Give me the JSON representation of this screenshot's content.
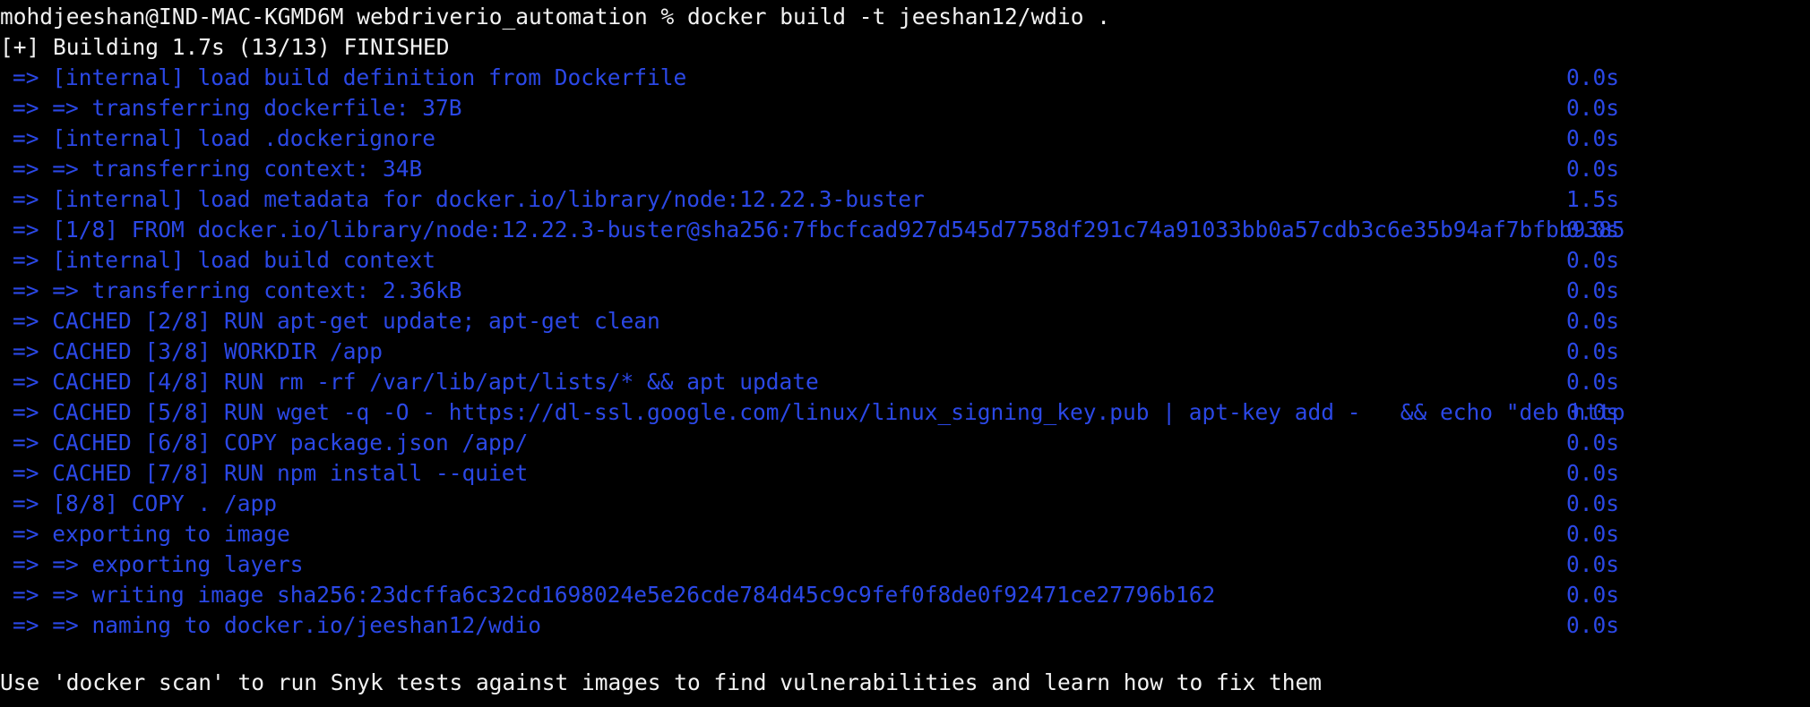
{
  "terminal": {
    "prompt": "mohdjeeshan@IND-MAC-KGMD6M webdriverio_automation % docker build -t jeeshan12/wdio .",
    "build_header": "[+] Building 1.7s (13/13) FINISHED",
    "steps": [
      {
        "text": "=> [internal] load build definition from Dockerfile",
        "time": "0.0s"
      },
      {
        "text": "=> => transferring dockerfile: 37B",
        "time": "0.0s"
      },
      {
        "text": "=> [internal] load .dockerignore",
        "time": "0.0s"
      },
      {
        "text": "=> => transferring context: 34B",
        "time": "0.0s"
      },
      {
        "text": "=> [internal] load metadata for docker.io/library/node:12.22.3-buster",
        "time": "1.5s"
      },
      {
        "text": "=> [1/8] FROM docker.io/library/node:12.22.3-buster@sha256:7fbcfcad927d545d7758df291c74a91033bb0a57cdb3c6e35b94af7bfbb9385",
        "time": "0.0s"
      },
      {
        "text": "=> [internal] load build context",
        "time": "0.0s"
      },
      {
        "text": "=> => transferring context: 2.36kB",
        "time": "0.0s"
      },
      {
        "text": "=> CACHED [2/8] RUN apt-get update; apt-get clean",
        "time": "0.0s"
      },
      {
        "text": "=> CACHED [3/8] WORKDIR /app",
        "time": "0.0s"
      },
      {
        "text": "=> CACHED [4/8] RUN rm -rf /var/lib/apt/lists/* && apt update",
        "time": "0.0s"
      },
      {
        "text": "=> CACHED [5/8] RUN wget -q -O - https://dl-ssl.google.com/linux/linux_signing_key.pub | apt-key add -   && echo \"deb http",
        "time": "0.0s"
      },
      {
        "text": "=> CACHED [6/8] COPY package.json /app/",
        "time": "0.0s"
      },
      {
        "text": "=> CACHED [7/8] RUN npm install --quiet",
        "time": "0.0s"
      },
      {
        "text": "=> [8/8] COPY . /app",
        "time": "0.0s"
      },
      {
        "text": "=> exporting to image",
        "time": "0.0s"
      },
      {
        "text": "=> => exporting layers",
        "time": "0.0s"
      },
      {
        "text": "=> => writing image sha256:23dcffa6c32cd1698024e5e26cde784d45c9c9fef0f8de0f92471ce27796b162",
        "time": "0.0s"
      },
      {
        "text": "=> => naming to docker.io/jeeshan12/wdio",
        "time": "0.0s"
      }
    ],
    "notice": "Use 'docker scan' to run Snyk tests against images to find vulnerabilities and learn how to fix them",
    "colors": {
      "background": "#000000",
      "default_text": "#f2f2f2",
      "buildkit_blue": "#2b48e6"
    }
  }
}
